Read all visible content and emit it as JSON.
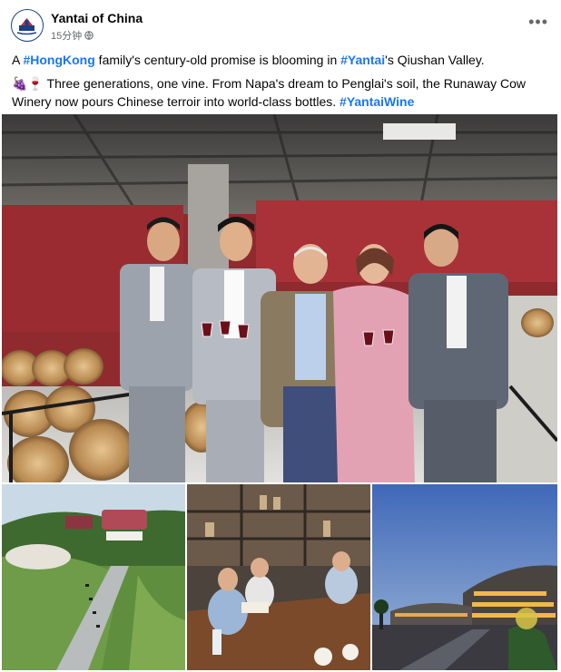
{
  "post": {
    "page_name": "Yantai of China",
    "time_ago": "15分钟",
    "more_icon": "more-horizontal-icon",
    "line1": {
      "t1": "A ",
      "tag1": "#HongKong",
      "t2": " family's century-old promise is blooming in ",
      "tag2": "#Yantai",
      "t3": "'s Qiushan Valley."
    },
    "line2": {
      "emoji": "🍇🍷",
      "text": " Three generations, one vine. From Napa's dream to Penglai's soil, the Runaway Cow Winery now pours Chinese terroir into world-class bottles. ",
      "tag": "#YantaiWine"
    }
  },
  "colors": {
    "link": "#1877f2",
    "meta_gray": "#65676b"
  }
}
